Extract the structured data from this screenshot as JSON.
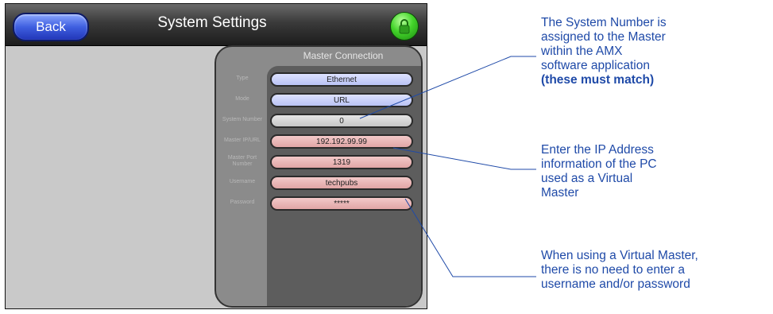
{
  "header": {
    "back_label": "Back",
    "title": "System Settings",
    "lock_icon": "padlock-icon"
  },
  "panel": {
    "title": "Master Connection",
    "rows": [
      {
        "label": "Type",
        "value": "Ethernet",
        "color": "#c5ccf7"
      },
      {
        "label": "Mode",
        "value": "URL",
        "color": "#c5ccf7"
      },
      {
        "label": "System Number",
        "value": "0",
        "color": "#d6d6d6"
      },
      {
        "label": "Master IP/URL",
        "value": "192.192.99.99",
        "color": "#eab4b4"
      },
      {
        "label": "Master Port Number",
        "value": "1319",
        "color": "#eab4b4"
      },
      {
        "label": "Username",
        "value": "techpubs",
        "color": "#eab4b4"
      },
      {
        "label": "Password",
        "value": "*****",
        "color": "#eab4b4"
      }
    ]
  },
  "callouts": [
    {
      "lines": [
        "The System Number is",
        "assigned to the Master",
        "within the AMX",
        "software application"
      ],
      "bold": "(these must match)"
    },
    {
      "lines": [
        "Enter the IP Address",
        "information of the PC",
        "used as a Virtual",
        "Master"
      ]
    },
    {
      "lines": [
        "When using a Virtual Master,",
        "there is no need to enter a",
        "username and/or password"
      ]
    }
  ]
}
